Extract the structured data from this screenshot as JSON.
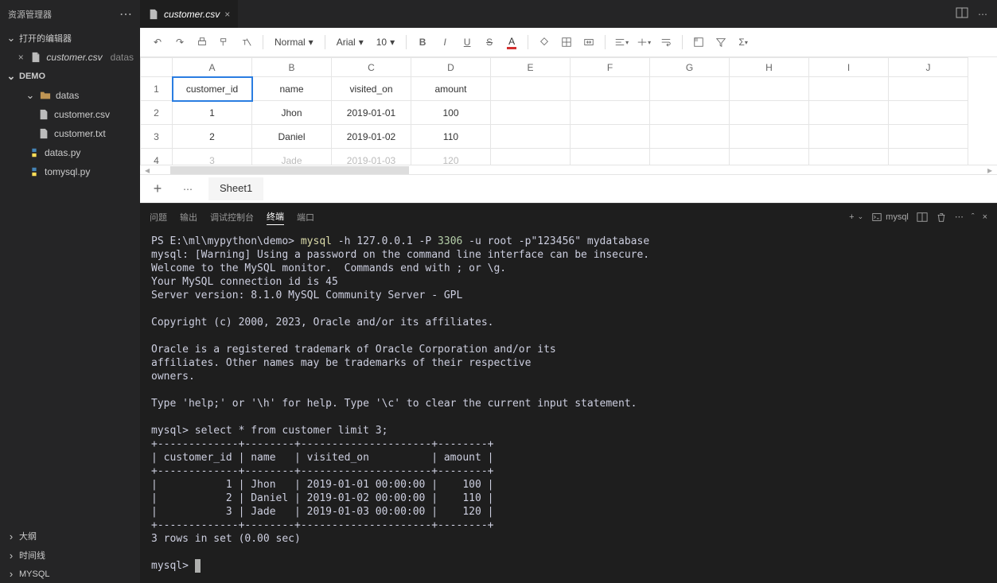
{
  "sidebar": {
    "title": "资源管理器",
    "open_editors_label": "打开的编辑器",
    "open_editor_file": "customer.csv",
    "open_editor_path": "datas",
    "project": "DEMO",
    "folder": "datas",
    "files": [
      "customer.csv",
      "customer.txt"
    ],
    "pyfiles": [
      "datas.py",
      "tomysql.py"
    ],
    "bottom": [
      "大纲",
      "时间线",
      "MYSQL"
    ]
  },
  "tab": {
    "title": "customer.csv"
  },
  "toolbar": {
    "normal": "Normal",
    "font": "Arial",
    "size": "10"
  },
  "grid": {
    "cols": [
      "A",
      "B",
      "C",
      "D",
      "E",
      "F",
      "G",
      "H",
      "I",
      "J"
    ],
    "rows": [
      [
        "customer_id",
        "name",
        "visited_on",
        "amount",
        "",
        "",
        "",
        "",
        "",
        ""
      ],
      [
        "1",
        "Jhon",
        "2019-01-01",
        "100",
        "",
        "",
        "",
        "",
        "",
        ""
      ],
      [
        "2",
        "Daniel",
        "2019-01-02",
        "110",
        "",
        "",
        "",
        "",
        "",
        ""
      ],
      [
        "3",
        "Jade",
        "2019-01-03",
        "120",
        "",
        "",
        "",
        "",
        "",
        ""
      ]
    ]
  },
  "sheet": {
    "tab": "Sheet1"
  },
  "panel": {
    "tabs": [
      "问题",
      "输出",
      "调试控制台",
      "终端",
      "端口"
    ],
    "profile": "mysql"
  },
  "terminal": {
    "ps": "PS E:\\ml\\mypython\\demo> ",
    "cmd1": "mysql",
    "args1": " -h 127.0.0.1 -P ",
    "port": "3306",
    "args2": " -u root -p\"123456\" mydatabase",
    "l1": "mysql: [Warning] Using a password on the command line interface can be insecure.",
    "l2": "Welcome to the MySQL monitor.  Commands end with ; or \\g.",
    "l3": "Your MySQL connection id is 45",
    "l4": "Server version: 8.1.0 MySQL Community Server - GPL",
    "l5": "Copyright (c) 2000, 2023, Oracle and/or its affiliates.",
    "l6": "Oracle is a registered trademark of Oracle Corporation and/or its",
    "l7": "affiliates. Other names may be trademarks of their respective",
    "l8": "owners.",
    "l9": "Type 'help;' or '\\h' for help. Type '\\c' to clear the current input statement.",
    "prompt": "mysql> ",
    "query": "select * from customer limit 3;",
    "sep": "+-------------+--------+---------------------+--------+",
    "hdr": "| customer_id | name   | visited_on          | amount |",
    "r1": "|           1 | Jhon   | 2019-01-01 00:00:00 |    100 |",
    "r2": "|           2 | Daniel | 2019-01-02 00:00:00 |    110 |",
    "r3": "|           3 | Jade   | 2019-01-03 00:00:00 |    120 |",
    "res": "3 rows in set (0.00 sec)"
  }
}
